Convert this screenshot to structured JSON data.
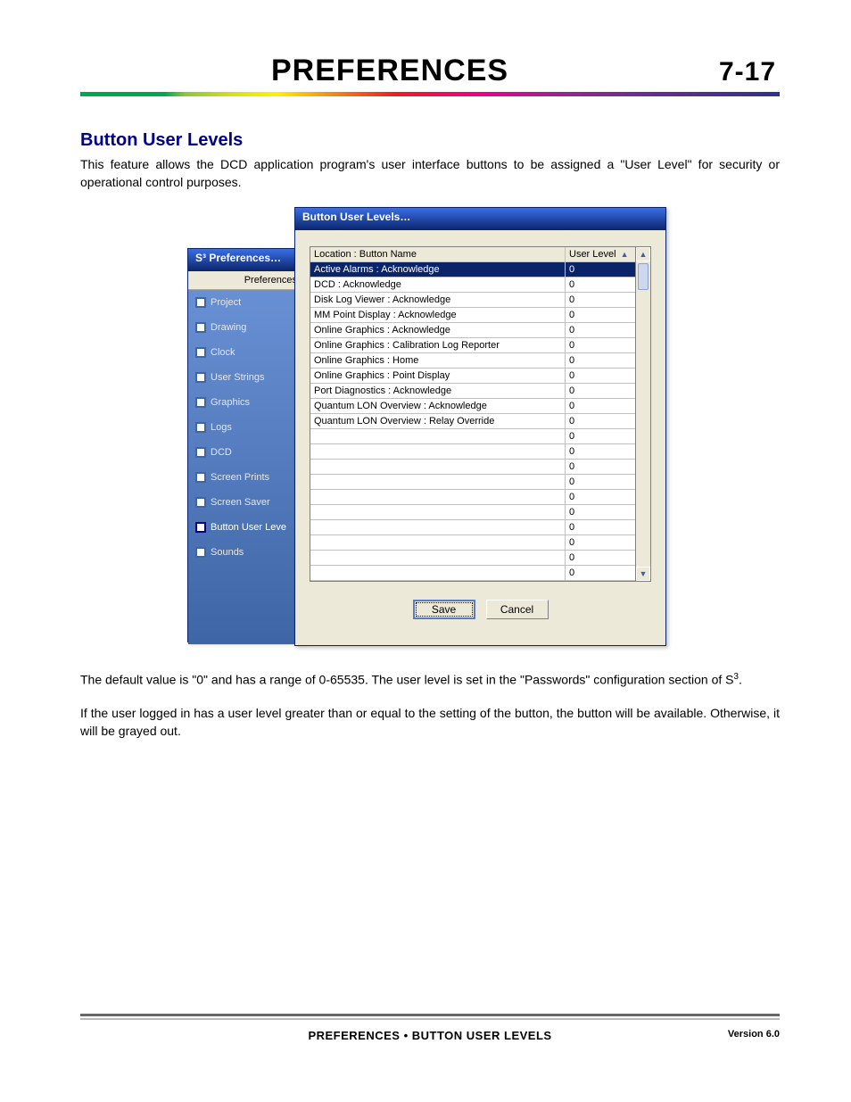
{
  "header": {
    "title": "PREFERENCES",
    "page_number": "7-17"
  },
  "section": {
    "heading": "Button User Levels",
    "intro": "This feature allows the DCD application program's user interface buttons to be assigned a \"User Level\" for security or operational control purposes."
  },
  "prefs_window": {
    "title": "S³ Preferences…",
    "heading": "Preferences",
    "nav": [
      "Project",
      "Drawing",
      "Clock",
      "User Strings",
      "Graphics",
      "Logs",
      "DCD",
      "Screen Prints",
      "Screen Saver",
      "Button User Leve",
      "Sounds"
    ],
    "selected_index": 9
  },
  "bul_window": {
    "title": "Button User Levels…",
    "columns": {
      "left": "Location : Button Name",
      "right": "User Level"
    },
    "rows": [
      {
        "name": "Active Alarms : Acknowledge",
        "level": "0",
        "selected": true
      },
      {
        "name": "DCD : Acknowledge",
        "level": "0"
      },
      {
        "name": "Disk Log Viewer : Acknowledge",
        "level": "0"
      },
      {
        "name": "MM Point Display : Acknowledge",
        "level": "0"
      },
      {
        "name": "Online Graphics : Acknowledge",
        "level": "0"
      },
      {
        "name": "Online Graphics : Calibration Log Reporter",
        "level": "0"
      },
      {
        "name": "Online Graphics : Home",
        "level": "0"
      },
      {
        "name": "Online Graphics : Point Display",
        "level": "0"
      },
      {
        "name": "Port Diagnostics : Acknowledge",
        "level": "0"
      },
      {
        "name": "Quantum LON Overview : Acknowledge",
        "level": "0"
      },
      {
        "name": "Quantum LON Overview : Relay Override",
        "level": "0"
      },
      {
        "name": "",
        "level": "0"
      },
      {
        "name": "",
        "level": "0"
      },
      {
        "name": "",
        "level": "0"
      },
      {
        "name": "",
        "level": "0"
      },
      {
        "name": "",
        "level": "0"
      },
      {
        "name": "",
        "level": "0"
      },
      {
        "name": "",
        "level": "0"
      },
      {
        "name": "",
        "level": "0"
      },
      {
        "name": "",
        "level": "0"
      },
      {
        "name": "",
        "level": "0"
      }
    ],
    "buttons": {
      "save": "Save",
      "cancel": "Cancel"
    }
  },
  "after": {
    "p1a": "The default value is \"0\" and has a range of 0-65535.  The user level is set in the \"Passwords\" configuration section of S",
    "p1b": ".",
    "p2": "If the user logged in has a user level greater than or equal to the setting of the button, the button will be available. Otherwise, it will be grayed out."
  },
  "footer": {
    "center": "PREFERENCES • BUTTON USER LEVELS",
    "right": "Version 6.0"
  }
}
